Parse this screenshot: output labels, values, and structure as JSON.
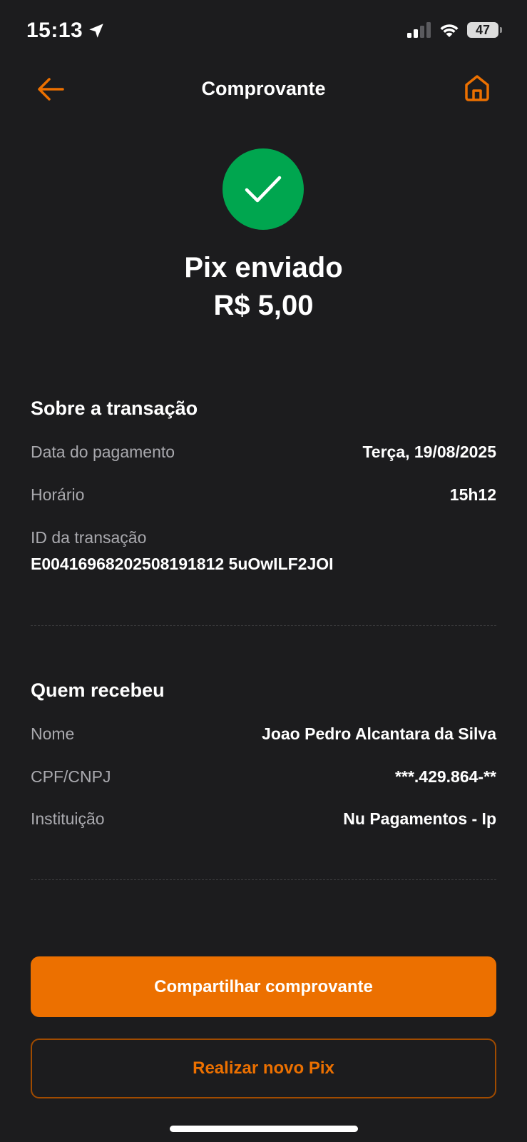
{
  "status_bar": {
    "time": "15:13",
    "battery": "47",
    "icons": [
      "location-arrow-icon",
      "cellular-signal-icon",
      "wifi-icon",
      "battery-icon"
    ]
  },
  "header": {
    "title": "Comprovante",
    "back_icon": "arrow-left-icon",
    "home_icon": "home-icon"
  },
  "success": {
    "icon": "checkmark-icon",
    "title": "Pix enviado",
    "amount": "R$ 5,00"
  },
  "transaction": {
    "section_title": "Sobre a transação",
    "date_label": "Data do pagamento",
    "date_value": "Terça, 19/08/2025",
    "time_label": "Horário",
    "time_value": "15h12",
    "id_label": "ID da transação",
    "id_value": "E00416968202508191812 5uOwILF2JOI"
  },
  "recipient": {
    "section_title": "Quem recebeu",
    "name_label": "Nome",
    "name_value": "Joao Pedro Alcantara da Silva",
    "doc_label": "CPF/CNPJ",
    "doc_value": "***.429.864-**",
    "institution_label": "Instituição",
    "institution_value": "Nu Pagamentos - Ip"
  },
  "actions": {
    "share_label": "Compartilhar comprovante",
    "new_pix_label": "Realizar novo Pix"
  },
  "colors": {
    "background": "#1c1c1e",
    "accent": "#ec7000",
    "success": "#00a64f",
    "muted_text": "#a9a9ae"
  }
}
